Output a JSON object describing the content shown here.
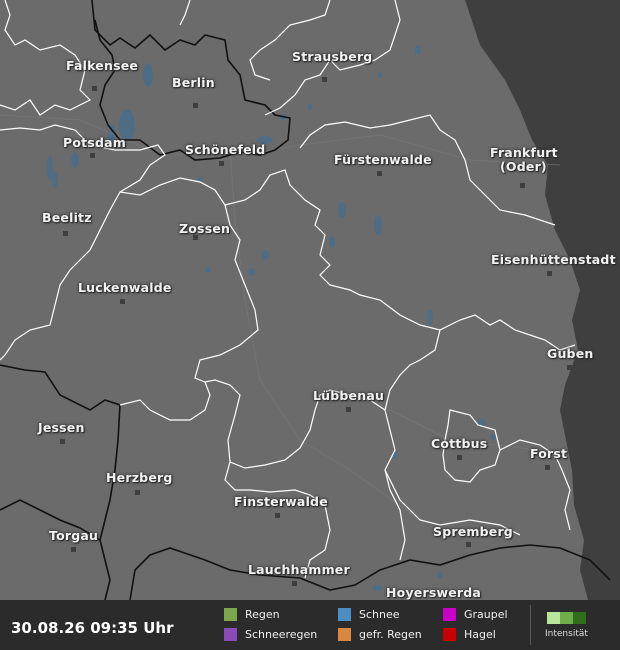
{
  "cities": [
    {
      "id": "falkensee",
      "name": "Falkensee"
    },
    {
      "id": "berlin",
      "name": "Berlin"
    },
    {
      "id": "strausberg",
      "name": "Strausberg"
    },
    {
      "id": "potsdam",
      "name": "Potsdam"
    },
    {
      "id": "schoenefeld",
      "name": "Schönefeld"
    },
    {
      "id": "fuerstenwalde",
      "name": "Fürstenwalde"
    },
    {
      "id": "frankfurt",
      "name": "Frankfurt"
    },
    {
      "id": "frankfurt-oder",
      "name": "(Oder)"
    },
    {
      "id": "beelitz",
      "name": "Beelitz"
    },
    {
      "id": "zossen",
      "name": "Zossen"
    },
    {
      "id": "eisenhuettenstadt",
      "name": "Eisenhüttenstadt"
    },
    {
      "id": "luckenwalde",
      "name": "Luckenwalde"
    },
    {
      "id": "guben",
      "name": "Guben"
    },
    {
      "id": "luebbenau",
      "name": "Lübbenau"
    },
    {
      "id": "jessen",
      "name": "Jessen"
    },
    {
      "id": "cottbus",
      "name": "Cottbus"
    },
    {
      "id": "forst",
      "name": "Forst"
    },
    {
      "id": "herzberg",
      "name": "Herzberg"
    },
    {
      "id": "finsterwalde",
      "name": "Finsterwalde"
    },
    {
      "id": "torgau",
      "name": "Torgau"
    },
    {
      "id": "spremberg",
      "name": "Spremberg"
    },
    {
      "id": "lauchhammer",
      "name": "Lauchhammer"
    },
    {
      "id": "hoyerswerda",
      "name": "Hoyerswerda"
    }
  ],
  "timestamp": "30.08.26 09:35 Uhr",
  "legend": {
    "regen": {
      "label": "Regen",
      "color": "#7aa84a"
    },
    "schnee": {
      "label": "Schnee",
      "color": "#4a8ec2"
    },
    "graupel": {
      "label": "Graupel",
      "color": "#c800c8"
    },
    "schneeregen": {
      "label": "Schneeregen",
      "color": "#8a4ab8"
    },
    "gefr_regen": {
      "label": "gefr. Regen",
      "color": "#d8873c"
    },
    "hagel": {
      "label": "Hagel",
      "color": "#c80000"
    },
    "intensity_label": "Intensität",
    "intensity_colors": [
      "#b8e69a",
      "#6fae4a",
      "#2f6e1a"
    ]
  },
  "colors": {
    "land": "#6b6b6b",
    "outside": "#3f3f3f",
    "water": "#4a6e8a",
    "district_border": "#ffffff",
    "state_border": "#111111"
  }
}
